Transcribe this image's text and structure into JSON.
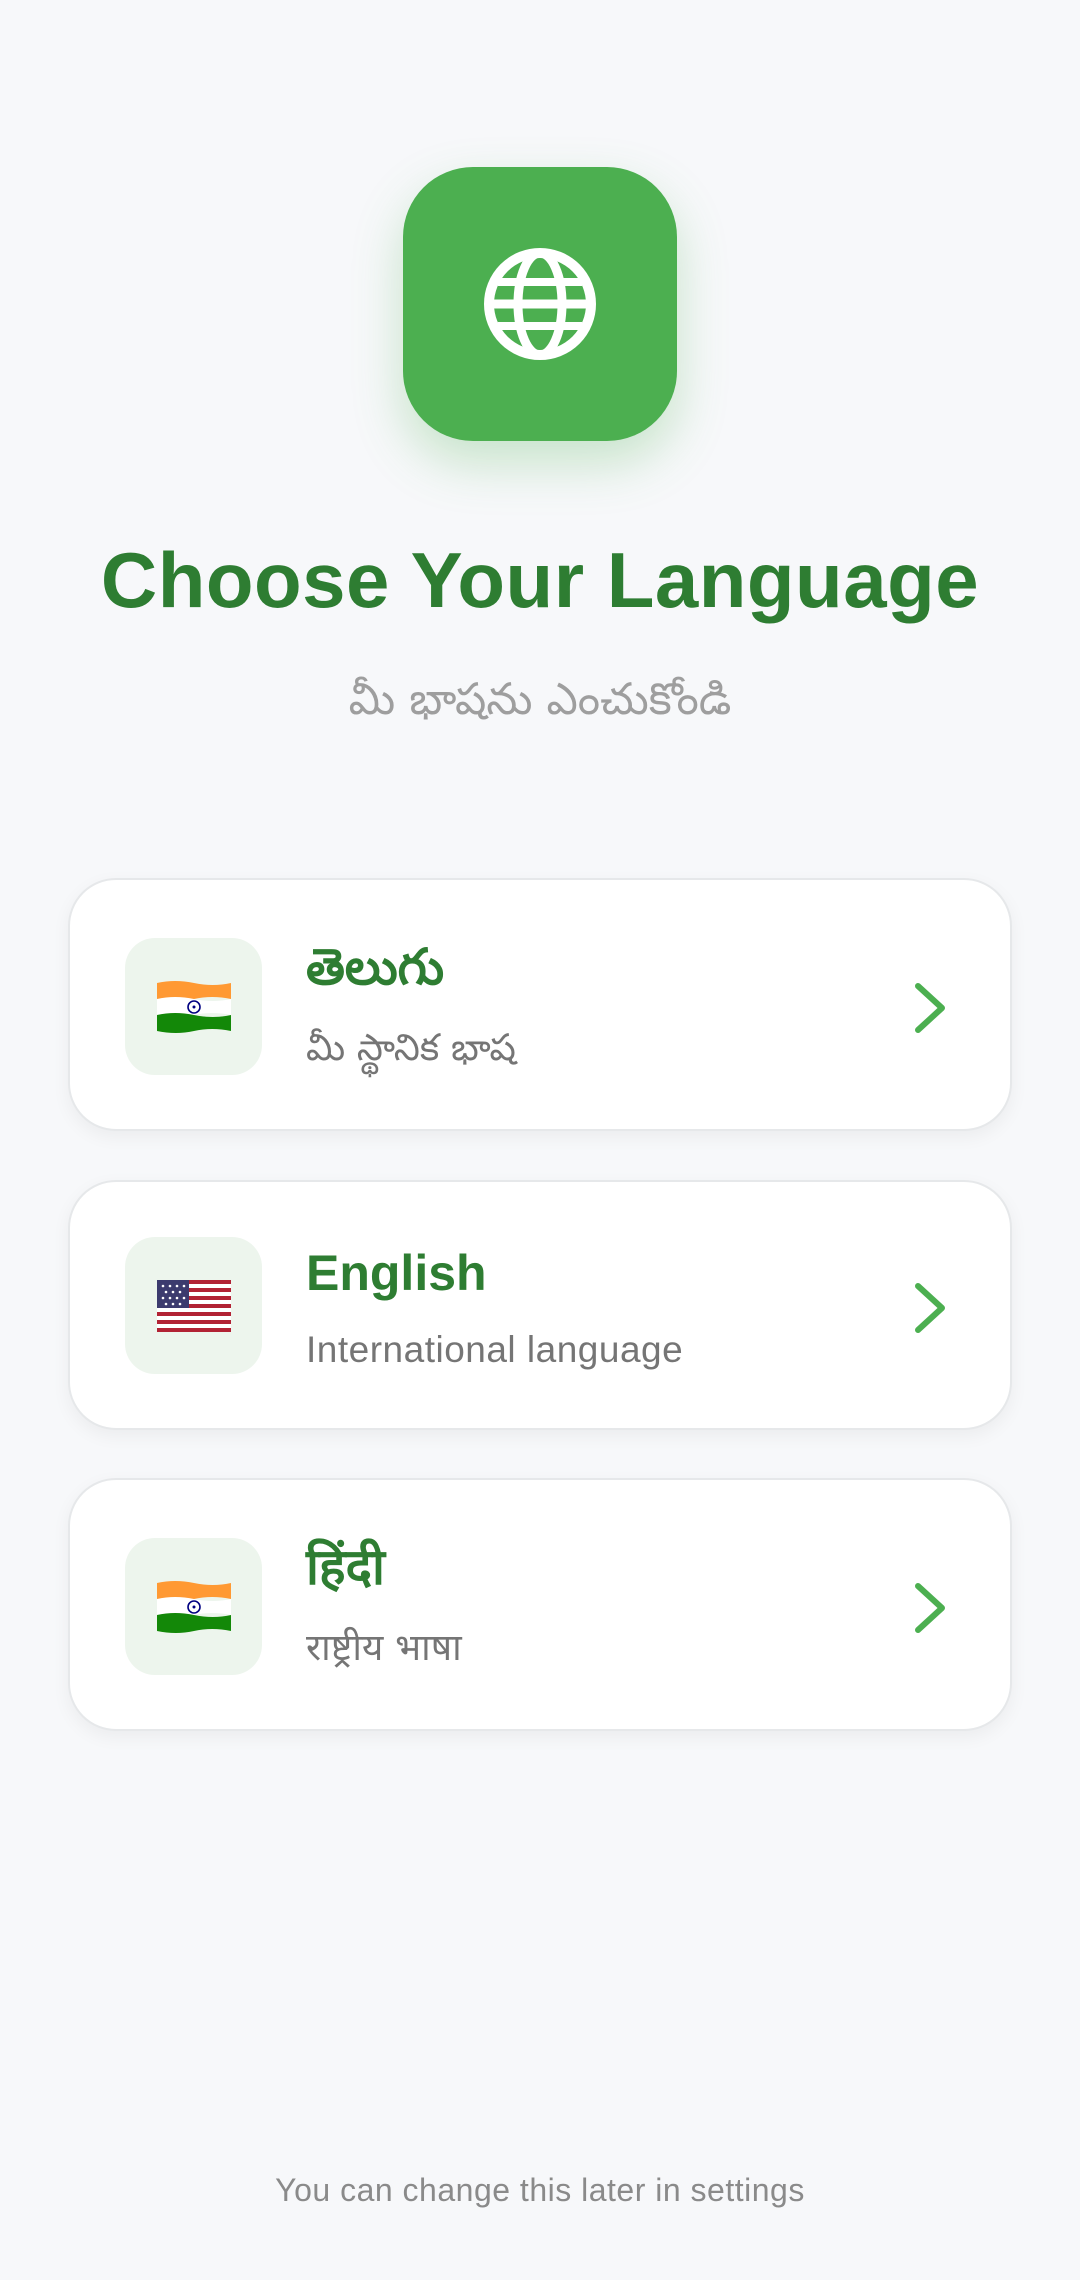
{
  "colors": {
    "accent": "#4caf50",
    "title": "#2e7d32",
    "background": "#f7f8fa"
  },
  "header": {
    "icon": "globe-icon",
    "title": "Choose Your Language",
    "subtitle": "మీ భాషను ఎంచుకోండి"
  },
  "languages": [
    {
      "name": "తెలుగు",
      "description": "మీ స్థానిక భాష",
      "flag": "india-flag-icon"
    },
    {
      "name": "English",
      "description": "International language",
      "flag": "usa-flag-icon"
    },
    {
      "name": "हिंदी",
      "description": "राष्ट्रीय भाषा",
      "flag": "india-flag-icon"
    }
  ],
  "footer": {
    "note": "You can change this later in settings"
  }
}
